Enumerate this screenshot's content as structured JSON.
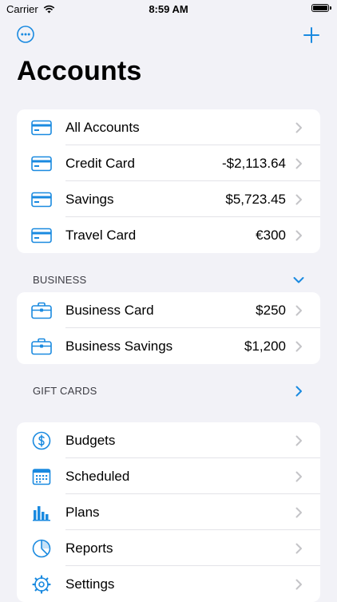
{
  "status": {
    "carrier": "Carrier",
    "time": "8:59 AM"
  },
  "nav": {
    "title": "Accounts",
    "more_icon": "ellipsis-circle-icon",
    "add_icon": "plus-icon"
  },
  "accounts": [
    {
      "label": "All Accounts",
      "value": "",
      "icon": "credit-card-icon"
    },
    {
      "label": "Credit Card",
      "value": "-$2,113.64",
      "icon": "credit-card-icon"
    },
    {
      "label": "Savings",
      "value": "$5,723.45",
      "icon": "credit-card-icon"
    },
    {
      "label": "Travel Card",
      "value": "€300",
      "icon": "credit-card-icon"
    }
  ],
  "business": {
    "header": "BUSINESS",
    "expanded": true,
    "items": [
      {
        "label": "Business Card",
        "value": "$250",
        "icon": "briefcase-icon"
      },
      {
        "label": "Business Savings",
        "value": "$1,200",
        "icon": "briefcase-icon"
      }
    ]
  },
  "gift_cards": {
    "header": "GIFT CARDS",
    "expanded": false
  },
  "tools": [
    {
      "label": "Budgets",
      "icon": "dollar-circle-icon"
    },
    {
      "label": "Scheduled",
      "icon": "calendar-icon"
    },
    {
      "label": "Plans",
      "icon": "bar-chart-icon"
    },
    {
      "label": "Reports",
      "icon": "pie-chart-icon"
    },
    {
      "label": "Settings",
      "icon": "gear-icon"
    }
  ],
  "colors": {
    "accent": "#1a8ae0",
    "chevron": "#c4c4c7",
    "background": "#f2f2f7"
  }
}
